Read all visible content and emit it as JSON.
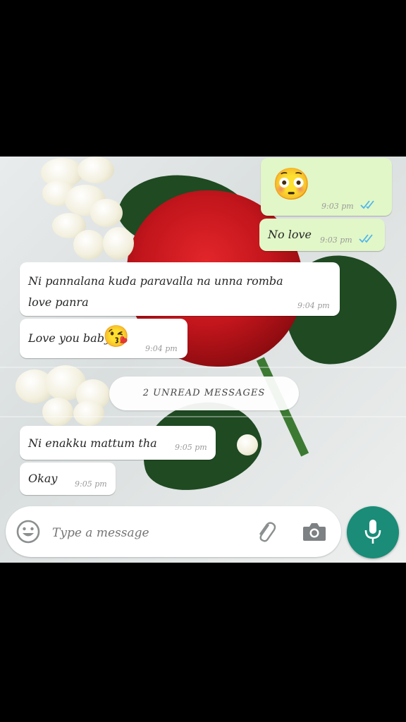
{
  "chat": {
    "sent": [
      {
        "emoji": "😳",
        "time": "9:03 pm"
      },
      {
        "text": "No love",
        "time": "9:03 pm"
      }
    ],
    "received_1": {
      "text": "Ni pannalana kuda paravalla na unna romba love panra",
      "time": "9:04 pm"
    },
    "received_2": {
      "text": "Love you baby",
      "emoji": "😘",
      "time": "9:04 pm"
    },
    "unread_banner": "2 UNREAD MESSAGES",
    "received_3": {
      "text": "Ni enakku mattum tha",
      "time": "9:05 pm"
    },
    "received_4": {
      "text": "Okay",
      "time": "9:05 pm"
    }
  },
  "input": {
    "placeholder": "Type a message",
    "icons": [
      "smiley-icon",
      "paperclip-icon",
      "camera-icon",
      "microphone-icon"
    ]
  },
  "colors": {
    "outgoing_bubble": "#e1f7c7",
    "incoming_bubble": "#ffffff",
    "read_ticks": "#4fb6ec",
    "mic_button": "#1a8c78"
  }
}
